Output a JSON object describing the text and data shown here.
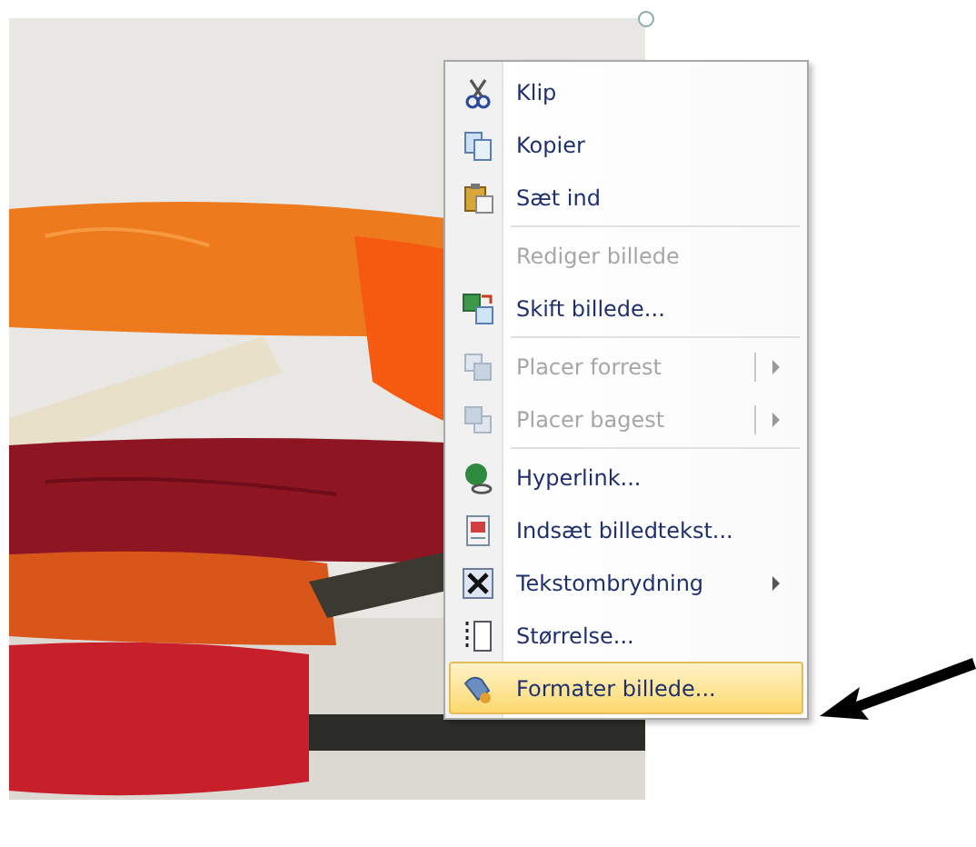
{
  "context_menu": {
    "items": [
      {
        "kind": "item",
        "label": "Klip",
        "disabled": false,
        "submenu": false,
        "split": false,
        "selected": false
      },
      {
        "kind": "item",
        "label": "Kopier",
        "disabled": false,
        "submenu": false,
        "split": false,
        "selected": false
      },
      {
        "kind": "item",
        "label": "Sæt ind",
        "disabled": false,
        "submenu": false,
        "split": false,
        "selected": false
      },
      {
        "kind": "separator"
      },
      {
        "kind": "item",
        "label": "Rediger billede",
        "disabled": true,
        "submenu": false,
        "split": false,
        "selected": false
      },
      {
        "kind": "item",
        "label": "Skift billede...",
        "disabled": false,
        "submenu": false,
        "split": false,
        "selected": false
      },
      {
        "kind": "separator"
      },
      {
        "kind": "item",
        "label": "Placer forrest",
        "disabled": true,
        "submenu": true,
        "split": true,
        "selected": false
      },
      {
        "kind": "item",
        "label": "Placer bagest",
        "disabled": true,
        "submenu": true,
        "split": true,
        "selected": false
      },
      {
        "kind": "separator"
      },
      {
        "kind": "item",
        "label": "Hyperlink...",
        "disabled": false,
        "submenu": false,
        "split": false,
        "selected": false
      },
      {
        "kind": "item",
        "label": "Indsæt billedtekst...",
        "disabled": false,
        "submenu": false,
        "split": false,
        "selected": false
      },
      {
        "kind": "item",
        "label": "Tekstombrydning",
        "disabled": false,
        "submenu": true,
        "split": false,
        "selected": false
      },
      {
        "kind": "item",
        "label": "Størrelse...",
        "disabled": false,
        "submenu": false,
        "split": false,
        "selected": false
      },
      {
        "kind": "item",
        "label": "Formater billede...",
        "disabled": false,
        "submenu": false,
        "split": false,
        "selected": true
      }
    ]
  }
}
